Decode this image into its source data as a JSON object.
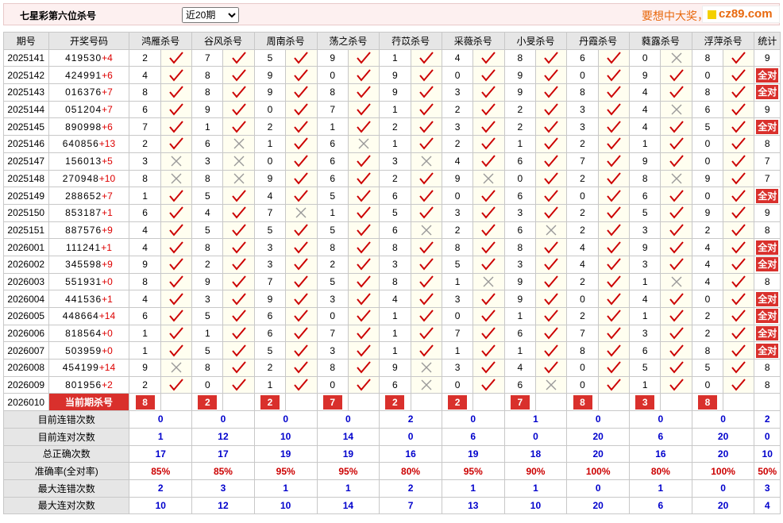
{
  "header": {
    "title": "七星彩第六位杀号",
    "range_selected": "近20期",
    "promo": "要想中大奖，",
    "logo": "cz89.com"
  },
  "columns": [
    "期号",
    "开奖号码",
    "鸿雁杀号",
    "谷风杀号",
    "周南杀号",
    "荡之杀号",
    "荇苡杀号",
    "采薇杀号",
    "小旻杀号",
    "丹霞杀号",
    "蕤露杀号",
    "浮萍杀号",
    "统计"
  ],
  "rows": [
    {
      "period": "2025141",
      "digits": "419530",
      "plus": "+4",
      "kills": [
        2,
        7,
        5,
        9,
        1,
        4,
        8,
        6,
        0,
        8
      ],
      "hits": [
        1,
        1,
        1,
        1,
        1,
        1,
        1,
        1,
        0,
        1
      ],
      "stat": "9"
    },
    {
      "period": "2025142",
      "digits": "424991",
      "plus": "+6",
      "kills": [
        4,
        8,
        9,
        0,
        9,
        0,
        9,
        0,
        9,
        0
      ],
      "hits": [
        1,
        1,
        1,
        1,
        1,
        1,
        1,
        1,
        1,
        1
      ],
      "stat": "全对"
    },
    {
      "period": "2025143",
      "digits": "016376",
      "plus": "+7",
      "kills": [
        8,
        8,
        9,
        8,
        9,
        3,
        9,
        8,
        4,
        8
      ],
      "hits": [
        1,
        1,
        1,
        1,
        1,
        1,
        1,
        1,
        1,
        1
      ],
      "stat": "全对"
    },
    {
      "period": "2025144",
      "digits": "051204",
      "plus": "+7",
      "kills": [
        6,
        9,
        0,
        7,
        1,
        2,
        2,
        3,
        4,
        6
      ],
      "hits": [
        1,
        1,
        1,
        1,
        1,
        1,
        1,
        1,
        0,
        1
      ],
      "stat": "9"
    },
    {
      "period": "2025145",
      "digits": "890998",
      "plus": "+6",
      "kills": [
        7,
        1,
        2,
        1,
        2,
        3,
        2,
        3,
        4,
        5
      ],
      "hits": [
        1,
        1,
        1,
        1,
        1,
        1,
        1,
        1,
        1,
        1
      ],
      "stat": "全对"
    },
    {
      "period": "2025146",
      "digits": "640856",
      "plus": "+13",
      "kills": [
        2,
        6,
        1,
        6,
        1,
        2,
        1,
        2,
        1,
        0
      ],
      "hits": [
        1,
        0,
        1,
        0,
        1,
        1,
        1,
        1,
        1,
        1
      ],
      "stat": "8"
    },
    {
      "period": "2025147",
      "digits": "156013",
      "plus": "+5",
      "kills": [
        3,
        3,
        0,
        6,
        3,
        4,
        6,
        7,
        9,
        0
      ],
      "hits": [
        0,
        0,
        1,
        1,
        0,
        1,
        1,
        1,
        1,
        1
      ],
      "stat": "7"
    },
    {
      "period": "2025148",
      "digits": "270948",
      "plus": "+10",
      "kills": [
        8,
        8,
        9,
        6,
        2,
        9,
        0,
        2,
        8,
        9
      ],
      "hits": [
        0,
        0,
        1,
        1,
        1,
        0,
        1,
        1,
        0,
        1
      ],
      "stat": "7"
    },
    {
      "period": "2025149",
      "digits": "288652",
      "plus": "+7",
      "kills": [
        1,
        5,
        4,
        5,
        6,
        0,
        6,
        0,
        6,
        0
      ],
      "hits": [
        1,
        1,
        1,
        1,
        1,
        1,
        1,
        1,
        1,
        1
      ],
      "stat": "全对"
    },
    {
      "period": "2025150",
      "digits": "853187",
      "plus": "+1",
      "kills": [
        6,
        4,
        7,
        1,
        5,
        3,
        3,
        2,
        5,
        9
      ],
      "hits": [
        1,
        1,
        0,
        1,
        1,
        1,
        1,
        1,
        1,
        1
      ],
      "stat": "9"
    },
    {
      "period": "2025151",
      "digits": "887576",
      "plus": "+9",
      "kills": [
        4,
        5,
        5,
        5,
        6,
        2,
        6,
        2,
        3,
        2
      ],
      "hits": [
        1,
        1,
        1,
        1,
        0,
        1,
        0,
        1,
        1,
        1
      ],
      "stat": "8"
    },
    {
      "period": "2026001",
      "digits": "111241",
      "plus": "+1",
      "kills": [
        4,
        8,
        3,
        8,
        8,
        8,
        8,
        4,
        9,
        4
      ],
      "hits": [
        1,
        1,
        1,
        1,
        1,
        1,
        1,
        1,
        1,
        1
      ],
      "stat": "全对"
    },
    {
      "period": "2026002",
      "digits": "345598",
      "plus": "+9",
      "kills": [
        9,
        2,
        3,
        2,
        3,
        5,
        3,
        4,
        3,
        4
      ],
      "hits": [
        1,
        1,
        1,
        1,
        1,
        1,
        1,
        1,
        1,
        1
      ],
      "stat": "全对"
    },
    {
      "period": "2026003",
      "digits": "551931",
      "plus": "+0",
      "kills": [
        8,
        9,
        7,
        5,
        8,
        1,
        9,
        2,
        1,
        4
      ],
      "hits": [
        1,
        1,
        1,
        1,
        1,
        0,
        1,
        1,
        0,
        1
      ],
      "stat": "8"
    },
    {
      "period": "2026004",
      "digits": "441536",
      "plus": "+1",
      "kills": [
        4,
        3,
        9,
        3,
        4,
        3,
        9,
        0,
        4,
        0
      ],
      "hits": [
        1,
        1,
        1,
        1,
        1,
        1,
        1,
        1,
        1,
        1
      ],
      "stat": "全对"
    },
    {
      "period": "2026005",
      "digits": "448664",
      "plus": "+14",
      "kills": [
        6,
        5,
        6,
        0,
        1,
        0,
        1,
        2,
        1,
        2
      ],
      "hits": [
        1,
        1,
        1,
        1,
        1,
        1,
        1,
        1,
        1,
        1
      ],
      "stat": "全对"
    },
    {
      "period": "2026006",
      "digits": "818564",
      "plus": "+0",
      "kills": [
        1,
        1,
        6,
        7,
        1,
        7,
        6,
        7,
        3,
        2
      ],
      "hits": [
        1,
        1,
        1,
        1,
        1,
        1,
        1,
        1,
        1,
        1
      ],
      "stat": "全对"
    },
    {
      "period": "2026007",
      "digits": "503959",
      "plus": "+0",
      "kills": [
        1,
        5,
        5,
        3,
        1,
        1,
        1,
        8,
        6,
        8
      ],
      "hits": [
        1,
        1,
        1,
        1,
        1,
        1,
        1,
        1,
        1,
        1
      ],
      "stat": "全对"
    },
    {
      "period": "2026008",
      "digits": "454199",
      "plus": "+14",
      "kills": [
        9,
        8,
        2,
        8,
        9,
        3,
        4,
        0,
        5,
        5
      ],
      "hits": [
        0,
        1,
        1,
        1,
        0,
        1,
        1,
        1,
        1,
        1
      ],
      "stat": "8"
    },
    {
      "period": "2026009",
      "digits": "801956",
      "plus": "+2",
      "kills": [
        2,
        0,
        1,
        0,
        6,
        0,
        6,
        0,
        1,
        0
      ],
      "hits": [
        1,
        1,
        1,
        1,
        0,
        1,
        0,
        1,
        1,
        1
      ],
      "stat": "8"
    }
  ],
  "current": {
    "period": "2026010",
    "label": "当前期杀号",
    "kills": [
      8,
      2,
      2,
      7,
      2,
      2,
      7,
      8,
      3,
      8
    ]
  },
  "summary": [
    {
      "label": "目前连错次数",
      "values": [
        "0",
        "0",
        "0",
        "0",
        "2",
        "0",
        "1",
        "0",
        "0",
        "0"
      ],
      "stat": "2",
      "red": false
    },
    {
      "label": "目前连对次数",
      "values": [
        "1",
        "12",
        "10",
        "14",
        "0",
        "6",
        "0",
        "20",
        "6",
        "20"
      ],
      "stat": "0",
      "red": false
    },
    {
      "label": "总正确次数",
      "values": [
        "17",
        "17",
        "19",
        "19",
        "16",
        "19",
        "18",
        "20",
        "16",
        "20"
      ],
      "stat": "10",
      "red": false
    },
    {
      "label": "准确率(全对率)",
      "values": [
        "85%",
        "85%",
        "95%",
        "95%",
        "80%",
        "95%",
        "90%",
        "100%",
        "80%",
        "100%"
      ],
      "stat": "50%",
      "red": true
    },
    {
      "label": "最大连错次数",
      "values": [
        "2",
        "3",
        "1",
        "1",
        "2",
        "1",
        "1",
        "0",
        "1",
        "0"
      ],
      "stat": "3",
      "red": false
    },
    {
      "label": "最大连对次数",
      "values": [
        "10",
        "12",
        "10",
        "14",
        "7",
        "13",
        "10",
        "20",
        "6",
        "20"
      ],
      "stat": "4",
      "red": false
    }
  ],
  "colors": {
    "tick": "#cc0000",
    "cross": "#999999",
    "badge": "#d9302c"
  }
}
